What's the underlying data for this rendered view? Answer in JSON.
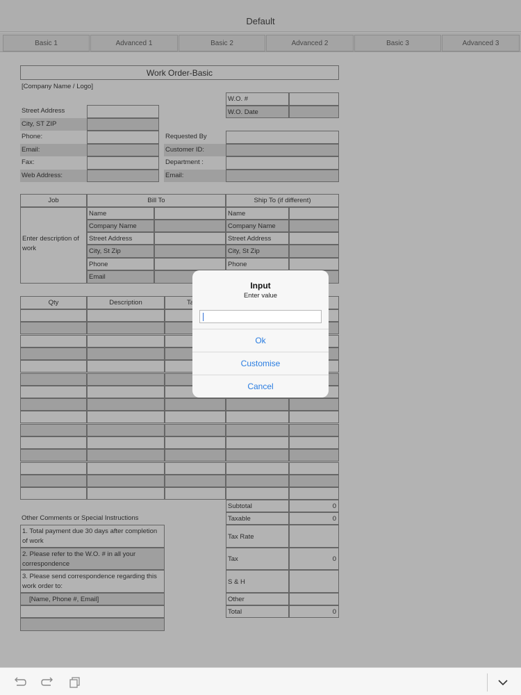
{
  "app": {
    "title": "Default"
  },
  "tabs": [
    "Basic 1",
    "Advanced 1",
    "Basic 2",
    "Advanced 2",
    "Basic 3",
    "Advanced 3"
  ],
  "sheet": {
    "form_title": "Work Order-Basic",
    "company_placeholder": "[Company Name / Logo]",
    "wo_number_label": "W.O. #",
    "wo_date_label": "W.O. Date",
    "left_labels": [
      "Street Address",
      "City, ST  ZIP",
      "Phone:",
      "Email:",
      "Fax:",
      "Web Address:"
    ],
    "right_labels": [
      "Requested By",
      "Customer ID:",
      "Department :",
      "Email:"
    ],
    "job_header": "Job",
    "bill_to_header": "Bill To",
    "ship_to_header": "Ship To (if different)",
    "job_description": "Enter description of work",
    "bill_fields": [
      "Name",
      "Company Name",
      "Street Address",
      "City, St Zip",
      "Phone",
      "Email"
    ],
    "ship_fields": [
      "Name",
      "Company Name",
      "Street Address",
      "City, St Zip",
      "Phone"
    ],
    "items_headers": [
      "Qty",
      "Description",
      "Ta"
    ],
    "comments_label": "Other Comments or Special Instructions",
    "instructions": [
      "1. Total payment due 30 days after completion of work",
      "2. Please refer to the W.O. # in all your correspondence",
      "3. Please send correspondence regarding this work order to:",
      "[Name, Phone #, Email]"
    ],
    "totals": [
      {
        "label": "Subtotal",
        "value": "0"
      },
      {
        "label": "Taxable",
        "value": "0"
      },
      {
        "label": "Tax Rate",
        "value": ""
      },
      {
        "label": "Tax",
        "value": "0"
      },
      {
        "label": "S & H",
        "value": ""
      },
      {
        "label": "Other",
        "value": ""
      },
      {
        "label": "Total",
        "value": "0"
      }
    ]
  },
  "dialog": {
    "title": "Input",
    "message": "Enter value",
    "input_value": "",
    "buttons": [
      "Ok",
      "Customise",
      "Cancel"
    ]
  },
  "toolbar_icons": [
    "undo-icon",
    "redo-icon",
    "copy-icon",
    "chevron-down-icon"
  ],
  "colors": {
    "accent": "#2a7de1",
    "dim_overlay": "#4b4b4b"
  }
}
